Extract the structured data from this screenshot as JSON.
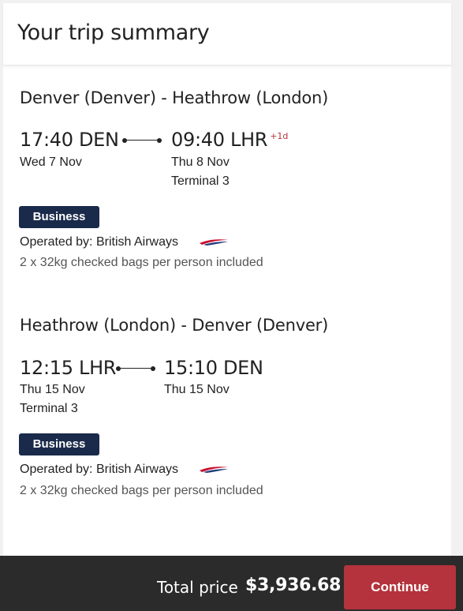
{
  "header": {
    "title": "Your trip summary"
  },
  "flights": [
    {
      "route": "Denver (Denver) - Heathrow (London)",
      "departure": {
        "time_code": "17:40 DEN",
        "date": "Wed 7 Nov",
        "terminal": ""
      },
      "arrival": {
        "time_code": "09:40 LHR",
        "day_offset": "+1d",
        "date": "Thu 8 Nov",
        "terminal": "Terminal 3"
      },
      "cabin": "Business",
      "operated_by": "Operated by: British Airways",
      "bags": "2 x 32kg checked bags per person included"
    },
    {
      "route": "Heathrow (London) - Denver (Denver)",
      "departure": {
        "time_code": "12:15 LHR",
        "date": "Thu 15 Nov",
        "terminal": "Terminal 3"
      },
      "arrival": {
        "time_code": "15:10 DEN",
        "day_offset": "",
        "date": "Thu 15 Nov",
        "terminal": ""
      },
      "cabin": "Business",
      "operated_by": "Operated by: British Airways",
      "bags": "2 x 32kg checked bags per person included"
    }
  ],
  "footer": {
    "total_label": "Total price",
    "total_value": "$3,936.68",
    "continue_label": "Continue"
  },
  "colors": {
    "brand_navy": "#1a2a4a",
    "accent_red": "#b5333c",
    "footer_bg": "#2b2b2b"
  },
  "icons": {
    "airline_logo": "british-airways-speedmarque-icon"
  }
}
